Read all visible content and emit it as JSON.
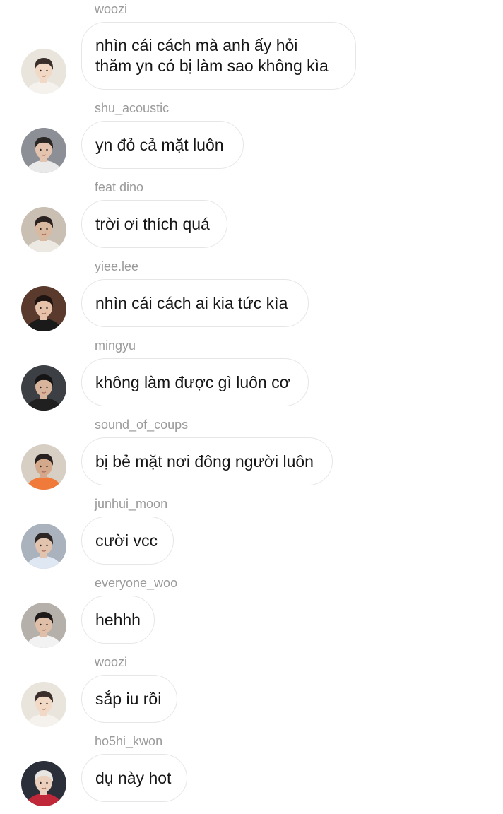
{
  "messages": [
    {
      "sender": "woozi",
      "text": "nhìn cái cách mà anh ấy hỏi\nthăm yn có bị làm sao không kìa",
      "avatar": {
        "icon": "avatar-woozi-icon",
        "bg": "#e9e4dc",
        "hair": "#3a2f2a",
        "skin": "#f1d9c6",
        "shirt": "#f5f2ee"
      }
    },
    {
      "sender": "shu_acoustic",
      "text": "yn đỏ cả mặt luôn",
      "avatar": {
        "icon": "avatar-shu-acoustic-icon",
        "bg": "#8c8f96",
        "hair": "#2a2624",
        "skin": "#e4c4ae",
        "shirt": "#e9e9e9"
      }
    },
    {
      "sender": "feat dino",
      "text": "trời ơi thích quá",
      "avatar": {
        "icon": "avatar-feat-dino-icon",
        "bg": "#c9bfb2",
        "hair": "#2a2220",
        "skin": "#d9b9a0",
        "shirt": "#ece8e2"
      }
    },
    {
      "sender": "yiee.lee",
      "text": "nhìn cái cách ai kia tức kìa",
      "avatar": {
        "icon": "avatar-yiee-lee-icon",
        "bg": "#5a3a2c",
        "hair": "#1e1412",
        "skin": "#e6c2ab",
        "shirt": "#1a1a1a"
      }
    },
    {
      "sender": "mingyu",
      "text": "không làm được gì luôn cơ",
      "avatar": {
        "icon": "avatar-mingyu-icon",
        "bg": "#3c3f44",
        "hair": "#151515",
        "skin": "#d8b49c",
        "shirt": "#202020"
      }
    },
    {
      "sender": "sound_of_coups",
      "text": "bị bẻ mặt nơi đông người luôn",
      "avatar": {
        "icon": "avatar-sound-of-coups-icon",
        "bg": "#d8cfc4",
        "hair": "#262120",
        "skin": "#d4a88a",
        "shirt": "#f07a3a"
      }
    },
    {
      "sender": "junhui_moon",
      "text": "cười vcc",
      "avatar": {
        "icon": "avatar-junhui-moon-icon",
        "bg": "#a9b2bd",
        "hair": "#2b2624",
        "skin": "#e2c3ad",
        "shirt": "#dfe8f2"
      }
    },
    {
      "sender": "everyone_woo",
      "text": "hehhh",
      "avatar": {
        "icon": "avatar-everyone-woo-icon",
        "bg": "#b6b0aa",
        "hair": "#1d1a19",
        "skin": "#e0bfa8",
        "shirt": "#f2f2f2"
      }
    },
    {
      "sender": "woozi",
      "text": "sắp iu rồi",
      "avatar": {
        "icon": "avatar-woozi-icon",
        "bg": "#e9e4dc",
        "hair": "#3a2f2a",
        "skin": "#f1d9c6",
        "shirt": "#f5f2ee"
      }
    },
    {
      "sender": "ho5hi_kwon",
      "text": "dụ này hot",
      "avatar": {
        "icon": "avatar-ho5hi-kwon-icon",
        "bg": "#2b2f3a",
        "hair": "#e8e6e2",
        "skin": "#ead0bd",
        "shirt": "#c0283a"
      }
    }
  ]
}
